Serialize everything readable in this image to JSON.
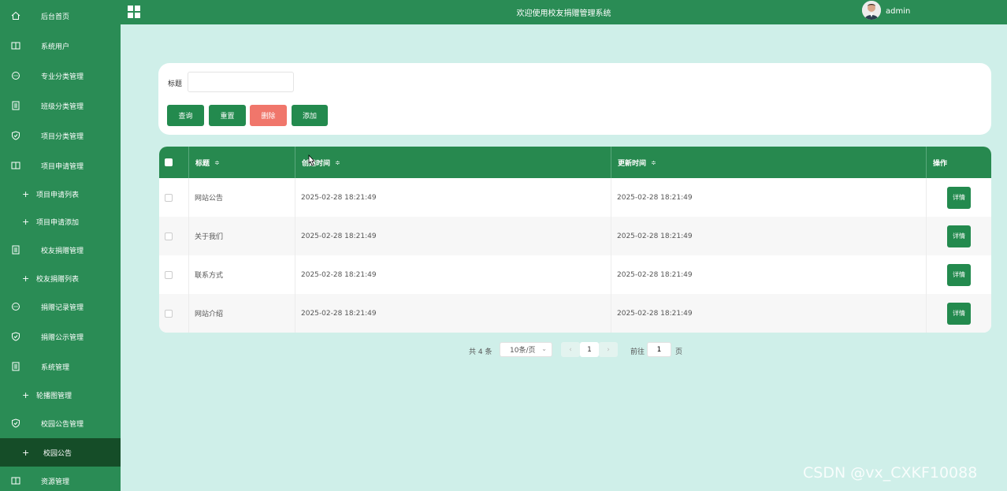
{
  "header": {
    "title": "欢迎使用校友捐赠管理系统",
    "username": "admin"
  },
  "sidebar": {
    "items": [
      {
        "label": "后台首页",
        "icon": "home-icon"
      },
      {
        "label": "系统用户",
        "icon": "columns-icon"
      },
      {
        "label": "专业分类管理",
        "icon": "chat-icon"
      },
      {
        "label": "班级分类管理",
        "icon": "document-icon"
      },
      {
        "label": "项目分类管理",
        "icon": "shield-icon"
      },
      {
        "label": "项目申请管理",
        "icon": "columns-icon"
      },
      {
        "label": "项目申请列表",
        "icon": "plus-icon"
      },
      {
        "label": "项目申请添加",
        "icon": "plus-icon"
      },
      {
        "label": "校友捐赠管理",
        "icon": "document-icon"
      },
      {
        "label": "校友捐赠列表",
        "icon": "plus-icon"
      },
      {
        "label": "捐赠记录管理",
        "icon": "chat-icon"
      },
      {
        "label": "捐赠公示管理",
        "icon": "shield-icon"
      },
      {
        "label": "系统管理",
        "icon": "document-icon"
      },
      {
        "label": "轮播图管理",
        "icon": "plus-icon"
      },
      {
        "label": "校园公告管理",
        "icon": "shield-icon"
      },
      {
        "label": "校园公告",
        "icon": "plus-icon"
      },
      {
        "label": "资源管理",
        "icon": "columns-icon"
      }
    ]
  },
  "search": {
    "label": "标题",
    "value": "",
    "placeholder": "",
    "buttons": {
      "query": "查询",
      "reset": "重置",
      "delete": "删除",
      "add": "添加"
    }
  },
  "table": {
    "headers": {
      "title": "标题",
      "created": "创建时间",
      "updated": "更新时间",
      "actions": "操作"
    },
    "sort_icon": "≑",
    "rows": [
      {
        "title": "网站公告",
        "created": "2025-02-28 18:21:49",
        "updated": "2025-02-28 18:21:49",
        "action": "详情"
      },
      {
        "title": "关于我们",
        "created": "2025-02-28 18:21:49",
        "updated": "2025-02-28 18:21:49",
        "action": "详情"
      },
      {
        "title": "联系方式",
        "created": "2025-02-28 18:21:49",
        "updated": "2025-02-28 18:21:49",
        "action": "详情"
      },
      {
        "title": "网站介绍",
        "created": "2025-02-28 18:21:49",
        "updated": "2025-02-28 18:21:49",
        "action": "详情"
      }
    ]
  },
  "pagination": {
    "total": "共 4 条",
    "page_size": "10条/页",
    "current_page": "1",
    "goto_label": "前往",
    "goto_value": "1",
    "page_suffix": "页"
  },
  "watermark": "CSDN @vx_CXKF10088",
  "colors": {
    "primary": "#2a8c55",
    "active": "#154d28",
    "danger": "#f0766b",
    "background": "#cfefe9"
  }
}
